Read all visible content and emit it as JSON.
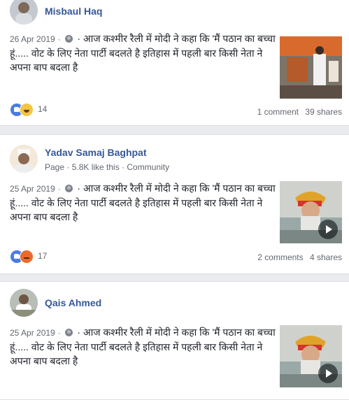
{
  "posts": [
    {
      "author": "Misbaul Haq",
      "subtitle": "",
      "date": "26 Apr 2019",
      "separator": "·",
      "text": "आज कश्मीर रैली में मोदी ने कहा कि 'मैं पठान का बच्चा हूं..... वोट के लिए नेता पार्टी बदलते है इतिहास में पहली बार किसी नेता ने अपना बाप बदला है",
      "reactions": [
        "like-icon",
        "haha-icon"
      ],
      "reaction_count": "14",
      "comments": "1 comment",
      "shares": "39 shares",
      "is_video": false
    },
    {
      "author": "Yadav Samaj Baghpat",
      "subtitle": "Page · 5.8K like this · Community",
      "date": "25 Apr 2019",
      "separator": "·",
      "text": "आज कश्मीर रैली में मोदी ने कहा कि 'मैं पठान का बच्चा हूं..... वोट के लिए नेता पार्टी बदलते है इतिहास में पहली बार किसी नेता ने अपना बाप बदला है",
      "reactions": [
        "like-icon",
        "angry-icon"
      ],
      "reaction_count": "17",
      "comments": "2 comments",
      "shares": "4 shares",
      "is_video": true
    },
    {
      "author": "Qais Ahmed",
      "subtitle": "",
      "date": "25 Apr 2019",
      "separator": "·",
      "text": "आज कश्मीर रैली में मोदी ने कहा कि 'मैं पठान का बच्चा हूं..... वोट के लिए नेता पार्टी बदलते है इतिहास में पहली बार किसी नेता ने अपना बाप बदला है",
      "reactions": [],
      "reaction_count": "",
      "comments": "",
      "shares": "",
      "is_video": true
    }
  ],
  "colors": {
    "background": "#e9ebee",
    "author_link": "#365899",
    "muted_text": "#616770"
  }
}
